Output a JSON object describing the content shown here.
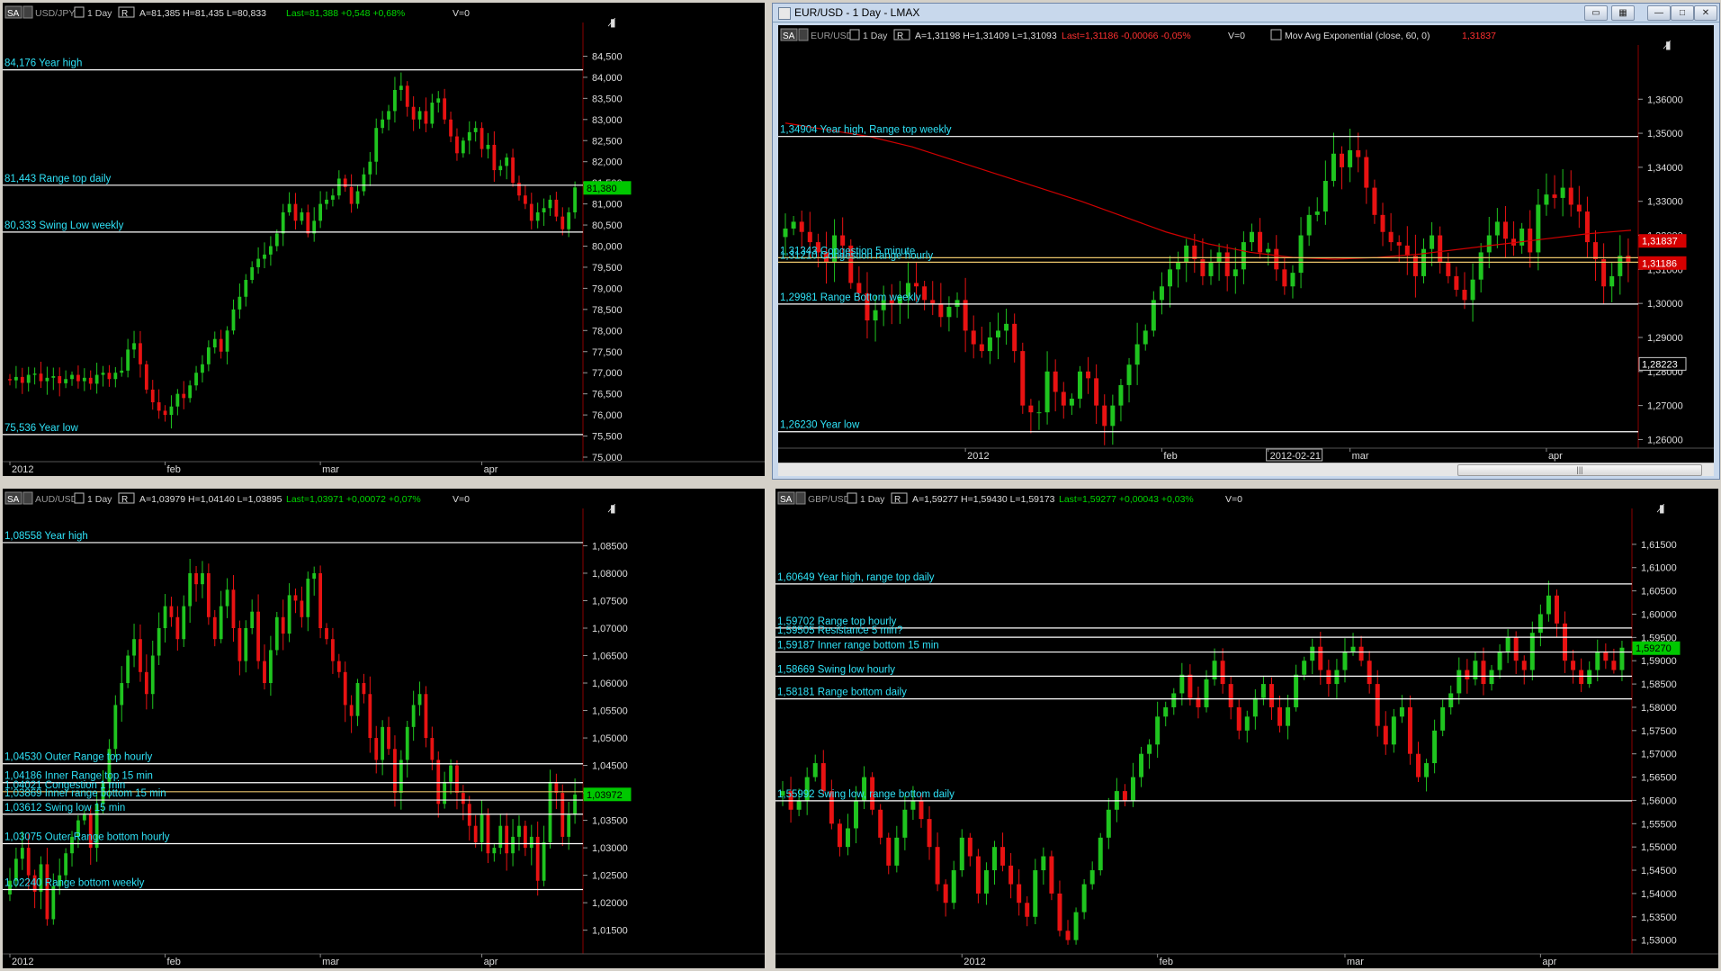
{
  "charts": [
    {
      "name": "usdjpy",
      "header": {
        "sa": "SA",
        "symbol": "USD/JPY",
        "period": "1 Day",
        "r": "R",
        "ohlc": "A=81,385  H=81,435  L=80,833",
        "last": "Last=81,388  +0,548  +0,68%",
        "lastColor": "#00d800",
        "vol": "V=0"
      },
      "chart_data": {
        "type": "candlestick",
        "ylim": [
          75.0,
          85.0
        ],
        "ytick_step": 0.5,
        "decimals": 3,
        "yticks": [
          "84,500",
          "84,000",
          "83,500",
          "83,000",
          "82,500",
          "82,000",
          "81,500",
          "81,000",
          "80,500",
          "80,000",
          "79,500",
          "79,000",
          "78,500",
          "78,000",
          "77,500",
          "77,000",
          "76,500",
          "76,000",
          "75,500",
          "75,000"
        ],
        "xlabels": [
          {
            "label": "2012",
            "i": 0
          },
          {
            "label": "feb",
            "i": 25
          },
          {
            "label": "mar",
            "i": 50
          },
          {
            "label": "apr",
            "i": 76
          }
        ],
        "n": 92,
        "ohlc_start": 76.85,
        "closes": [
          76.82,
          76.9,
          76.76,
          76.95,
          76.98,
          76.8,
          76.88,
          76.92,
          76.75,
          76.85,
          76.95,
          76.8,
          76.88,
          76.74,
          76.95,
          77.0,
          76.85,
          77.0,
          77.05,
          77.55,
          77.7,
          77.2,
          76.6,
          76.3,
          76.1,
          76.0,
          76.2,
          76.5,
          76.4,
          76.7,
          77.0,
          77.2,
          77.6,
          77.8,
          77.5,
          78.0,
          78.5,
          78.8,
          79.2,
          79.5,
          79.7,
          79.8,
          80.0,
          80.3,
          80.8,
          81.0,
          80.6,
          80.8,
          80.3,
          80.6,
          81.0,
          81.1,
          81.2,
          81.6,
          81.4,
          81.0,
          81.3,
          81.7,
          82.0,
          82.8,
          83.0,
          83.2,
          83.7,
          83.8,
          83.3,
          83.0,
          83.2,
          82.9,
          83.4,
          83.5,
          83.0,
          82.6,
          82.2,
          82.5,
          82.7,
          82.8,
          82.3,
          82.4,
          81.8,
          81.9,
          82.1,
          81.5,
          81.2,
          81.0,
          80.6,
          80.8,
          80.9,
          81.1,
          80.7,
          80.4,
          80.8,
          81.39
        ],
        "levels": [
          {
            "label": "84,176 Year high",
            "value": 84.176,
            "color": "#ffffff"
          },
          {
            "label": "81,443 Range top daily",
            "value": 81.443,
            "color": "#ffffff"
          },
          {
            "label": "80,333 Swing Low weekly",
            "value": 80.333,
            "color": "#ffffff"
          },
          {
            "label": "75,536 Year low",
            "value": 75.536,
            "color": "#ffffff"
          }
        ],
        "price_tags": [
          {
            "label": "81,380",
            "value": 81.38,
            "bg": "#00c800",
            "fg": "#000"
          }
        ]
      }
    },
    {
      "name": "eurusd",
      "window_title": "EUR/USD - 1 Day - LMAX",
      "header": {
        "sa": "SA",
        "symbol": "EUR/USD",
        "period": "1 Day",
        "r": "R",
        "ohlc": "A=1,31198  H=1,31409  L=1,31093",
        "last": "Last=1,31186  -0,00066  -0,05%",
        "lastColor": "#ff3030",
        "vol": "V=0",
        "indicator": "Mov Avg Exponential  (close, 60, 0)",
        "indicator_value": "1,31837"
      },
      "chart_data": {
        "type": "candlestick",
        "ylim": [
          1.258,
          1.368
        ],
        "ytick_step": 0.01,
        "decimals": 5,
        "yticks": [
          "1,36000",
          "1,35000",
          "1,34000",
          "1,33000",
          "1,32000",
          "1,31000",
          "1,30000",
          "1,29000",
          "1,28000",
          "1,27000",
          "1,26000"
        ],
        "xlabels": [
          {
            "label": "2012",
            "i": 22
          },
          {
            "label": "feb",
            "i": 46
          },
          {
            "label": "2012-02-21",
            "i": 59
          },
          {
            "label": "mar",
            "i": 69
          },
          {
            "label": "apr",
            "i": 93
          }
        ],
        "n": 104,
        "ohlc_start": 1.3195,
        "closes": [
          1.322,
          1.324,
          1.321,
          1.318,
          1.315,
          1.312,
          1.32,
          1.317,
          1.306,
          1.303,
          1.295,
          1.298,
          1.301,
          1.3,
          1.302,
          1.306,
          1.305,
          1.301,
          1.3,
          1.296,
          1.299,
          1.301,
          1.292,
          1.288,
          1.286,
          1.29,
          1.292,
          1.294,
          1.286,
          1.27,
          1.268,
          1.268,
          1.28,
          1.274,
          1.27,
          1.272,
          1.28,
          1.278,
          1.27,
          1.264,
          1.27,
          1.276,
          1.282,
          1.288,
          1.292,
          1.301,
          1.305,
          1.31,
          1.312,
          1.317,
          1.313,
          1.308,
          1.312,
          1.315,
          1.308,
          1.31,
          1.318,
          1.321,
          1.315,
          1.316,
          1.31,
          1.305,
          1.309,
          1.32,
          1.326,
          1.327,
          1.336,
          1.344,
          1.34,
          1.345,
          1.343,
          1.334,
          1.326,
          1.321,
          1.318,
          1.317,
          1.314,
          1.308,
          1.316,
          1.32,
          1.312,
          1.308,
          1.304,
          1.301,
          1.307,
          1.315,
          1.32,
          1.324,
          1.319,
          1.317,
          1.322,
          1.315,
          1.329,
          1.332,
          1.331,
          1.334,
          1.329,
          1.327,
          1.318,
          1.313,
          1.305,
          1.308,
          1.314,
          1.3119
        ],
        "levels": [
          {
            "label": "1,34904 Year high, Range top weekly",
            "value": 1.34904,
            "color": "#ffffff"
          },
          {
            "label": "1,31343 Congestion 5 minute",
            "value": 1.31343,
            "color": "#e8c36a"
          },
          {
            "label": "1,31210 Congestion range hourly",
            "value": 1.3121,
            "color": "#e8c36a"
          },
          {
            "label": "1,29981 Range Bottom weekly",
            "value": 1.29981,
            "color": "#ffffff"
          },
          {
            "label": "1,26230 Year low",
            "value": 1.2623,
            "color": "#ffffff"
          }
        ],
        "ema": [
          1.353,
          1.351,
          1.349,
          1.346,
          1.342,
          1.338,
          1.334,
          1.33,
          1.3255,
          1.321,
          1.3175,
          1.315,
          1.3135,
          1.313,
          1.3135,
          1.3145,
          1.316,
          1.3175,
          1.319,
          1.3205,
          1.3215
        ],
        "price_tags": [
          {
            "label": "1,31837",
            "value": 1.31837,
            "bg": "#d40000",
            "fg": "#fff"
          },
          {
            "label": "1,31186",
            "value": 1.31186,
            "bg": "#d40000",
            "fg": "#fff"
          },
          {
            "label": "1,28223",
            "value": 1.28223,
            "bg": "#000",
            "fg": "#fff",
            "outline": "#cccccc"
          }
        ]
      }
    },
    {
      "name": "audusd",
      "header": {
        "sa": "SA",
        "symbol": "AUD/USD",
        "period": "1 Day",
        "r": "R",
        "ohlc": "A=1,03979  H=1,04140  L=1,03895",
        "last": "Last=1,03971  +0,00072  +0,07%",
        "lastColor": "#00d800",
        "vol": "V=0"
      },
      "chart_data": {
        "type": "candlestick",
        "ylim": [
          1.0115,
          1.0895
        ],
        "ytick_step": 0.005,
        "decimals": 5,
        "yticks": [
          "1,08500",
          "1,08000",
          "1,07500",
          "1,07000",
          "1,06500",
          "1,06000",
          "1,05500",
          "1,05000",
          "1,04500",
          "1,04000",
          "1,03500",
          "1,03000",
          "1,02500",
          "1,02000",
          "1,01500"
        ],
        "xlabels": [
          {
            "label": "2012",
            "i": 0
          },
          {
            "label": "feb",
            "i": 25
          },
          {
            "label": "mar",
            "i": 50
          },
          {
            "label": "apr",
            "i": 76
          }
        ],
        "n": 92,
        "ohlc_start": 1.0215,
        "closes": [
          1.024,
          1.028,
          1.03,
          1.025,
          1.022,
          1.027,
          1.017,
          1.023,
          1.025,
          1.029,
          1.032,
          1.035,
          1.036,
          1.03,
          1.038,
          1.042,
          1.048,
          1.056,
          1.06,
          1.065,
          1.068,
          1.062,
          1.058,
          1.065,
          1.07,
          1.074,
          1.072,
          1.068,
          1.074,
          1.08,
          1.078,
          1.08,
          1.072,
          1.068,
          1.074,
          1.077,
          1.07,
          1.064,
          1.07,
          1.073,
          1.064,
          1.06,
          1.066,
          1.072,
          1.069,
          1.076,
          1.075,
          1.072,
          1.079,
          1.08,
          1.07,
          1.068,
          1.064,
          1.062,
          1.056,
          1.054,
          1.06,
          1.058,
          1.05,
          1.046,
          1.052,
          1.048,
          1.04,
          1.046,
          1.052,
          1.056,
          1.058,
          1.05,
          1.046,
          1.038,
          1.042,
          1.045,
          1.04,
          1.038,
          1.034,
          1.031,
          1.036,
          1.029,
          1.03,
          1.034,
          1.029,
          1.032,
          1.034,
          1.03,
          1.032,
          1.024,
          1.031,
          1.042,
          1.04,
          1.032,
          1.036,
          1.0397
        ],
        "levels": [
          {
            "label": "1,08558 Year high",
            "value": 1.08558,
            "color": "#ffffff"
          },
          {
            "label": "1,04530 Outer Range top hourly",
            "value": 1.0453,
            "color": "#ffffff"
          },
          {
            "label": "1,04186 Inner Range top 15 min",
            "value": 1.04186,
            "color": "#ffffff"
          },
          {
            "label": "1,04021 Congestion 1 min",
            "value": 1.04021,
            "color": "#e8c36a"
          },
          {
            "label": "1,03869 Inner range bottom 15 min",
            "value": 1.03869,
            "color": "#ffffff"
          },
          {
            "label": "1,03612 Swing low 15 min",
            "value": 1.03612,
            "color": "#ffffff"
          },
          {
            "label": "1,03075 Outer Range bottom hourly",
            "value": 1.03075,
            "color": "#ffffff"
          },
          {
            "label": "1,02240 Range bottom weekly",
            "value": 1.0224,
            "color": "#ffffff"
          }
        ],
        "price_tags": [
          {
            "label": "1,03972",
            "value": 1.03972,
            "bg": "#00c800",
            "fg": "#000"
          }
        ]
      }
    },
    {
      "name": "gbpusd",
      "header": {
        "sa": "SA",
        "symbol": "GBP/USD",
        "period": "1 Day",
        "r": "R",
        "ohlc": "A=1,59277  H=1,59430  L=1,59173",
        "last": "Last=1,59277  +0,00043  +0,03%",
        "lastColor": "#00d800",
        "vol": "V=0"
      },
      "chart_data": {
        "type": "candlestick",
        "ylim": [
          1.528,
          1.62
        ],
        "ytick_step": 0.005,
        "decimals": 5,
        "yticks": [
          "1,61500",
          "1,61000",
          "1,60500",
          "1,60000",
          "1,59500",
          "1,59000",
          "1,58500",
          "1,58000",
          "1,57500",
          "1,57000",
          "1,56500",
          "1,56000",
          "1,55500",
          "1,55000",
          "1,54500",
          "1,54000",
          "1,53500",
          "1,53000"
        ],
        "xlabels": [
          {
            "label": "2012",
            "i": 22
          },
          {
            "label": "feb",
            "i": 46
          },
          {
            "label": "mar",
            "i": 69
          },
          {
            "label": "apr",
            "i": 93
          }
        ],
        "n": 104,
        "ohlc_start": 1.561,
        "closes": [
          1.562,
          1.558,
          1.56,
          1.565,
          1.568,
          1.562,
          1.555,
          1.55,
          1.554,
          1.56,
          1.565,
          1.558,
          1.552,
          1.546,
          1.552,
          1.558,
          1.56,
          1.556,
          1.55,
          1.542,
          1.538,
          1.545,
          1.552,
          1.548,
          1.54,
          1.545,
          1.55,
          1.546,
          1.542,
          1.538,
          1.535,
          1.545,
          1.548,
          1.54,
          1.532,
          1.53,
          1.536,
          1.542,
          1.545,
          1.552,
          1.558,
          1.562,
          1.56,
          1.565,
          1.57,
          1.572,
          1.578,
          1.58,
          1.583,
          1.587,
          1.582,
          1.58,
          1.586,
          1.59,
          1.585,
          1.58,
          1.575,
          1.578,
          1.582,
          1.585,
          1.58,
          1.576,
          1.58,
          1.587,
          1.59,
          1.593,
          1.588,
          1.585,
          1.588,
          1.592,
          1.593,
          1.59,
          1.585,
          1.576,
          1.572,
          1.578,
          1.58,
          1.57,
          1.565,
          1.568,
          1.575,
          1.58,
          1.583,
          1.588,
          1.586,
          1.59,
          1.585,
          1.588,
          1.592,
          1.595,
          1.59,
          1.588,
          1.596,
          1.6,
          1.604,
          1.598,
          1.59,
          1.588,
          1.585,
          1.588,
          1.592,
          1.59,
          1.588,
          1.5928
        ],
        "levels": [
          {
            "label": "1,60649 Year high, range top daily",
            "value": 1.60649,
            "color": "#ffffff"
          },
          {
            "label": "1,59702 Range top hourly",
            "value": 1.59702,
            "color": "#ffffff"
          },
          {
            "label": "1,59505 Resistance 5 min?",
            "value": 1.59505,
            "color": "#ffffff"
          },
          {
            "label": "1,59187 Inner range bottom 15 min",
            "value": 1.59187,
            "color": "#ffffff"
          },
          {
            "label": "1,58669 Swing low hourly",
            "value": 1.58669,
            "color": "#ffffff"
          },
          {
            "label": "1,58181 Range bottom daily",
            "value": 1.58181,
            "color": "#ffffff"
          },
          {
            "label": "1,55992 Swing low, range bottom daily",
            "value": 1.55992,
            "color": "#ffffff"
          }
        ],
        "price_tags": [
          {
            "label": "1,59270",
            "value": 1.5927,
            "bg": "#00c800",
            "fg": "#000"
          }
        ]
      }
    }
  ],
  "icons": {
    "pin": "pin-icon",
    "close": "close-icon",
    "dropdown": "dropdown-icon"
  }
}
